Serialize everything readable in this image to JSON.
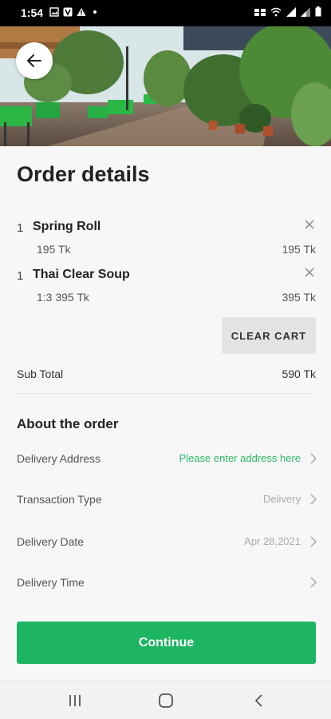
{
  "status_bar": {
    "time": "1:54"
  },
  "page": {
    "title": "Order details"
  },
  "cart": {
    "items": [
      {
        "qty": "1",
        "name": "Spring Roll",
        "unit_price": "195 Tk",
        "total": "195 Tk"
      },
      {
        "qty": "1",
        "name": "Thai Clear Soup",
        "unit_price": "1:3 395 Tk",
        "total": "395 Tk"
      }
    ],
    "clear_label": "CLEAR CART",
    "subtotal_label": "Sub Total",
    "subtotal_value": "590 Tk"
  },
  "about": {
    "title": "About the order",
    "rows": [
      {
        "label": "Delivery Address",
        "value": "Please enter address here"
      },
      {
        "label": "Transaction Type",
        "value": "Delivery"
      },
      {
        "label": "Delivery Date",
        "value": "Apr 28,2021"
      },
      {
        "label": "Delivery Time",
        "value": ""
      }
    ]
  },
  "continue_label": "Continue",
  "colors": {
    "accent": "#1db462",
    "link_green": "#2bb566",
    "status_bar": "#000000"
  }
}
